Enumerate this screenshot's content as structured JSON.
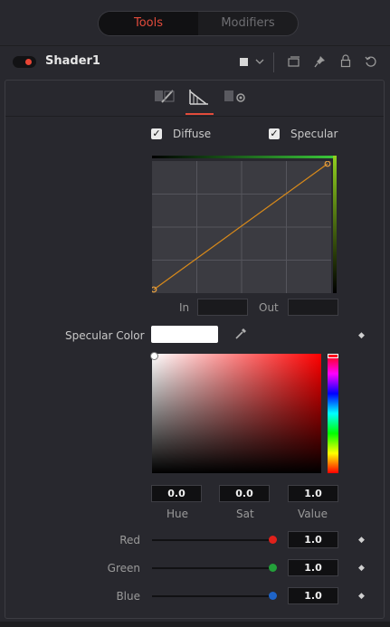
{
  "tabs": {
    "active": "Tools",
    "inactive": "Modifiers"
  },
  "node": {
    "name": "Shader1"
  },
  "header_icons": [
    "color-swatch-square",
    "chevron-down-icon",
    "window-icon",
    "pin-icon",
    "lock-icon",
    "reset-icon"
  ],
  "subtab_icons": [
    "paint-icon",
    "curve-icon",
    "settings-icon"
  ],
  "checkboxes": {
    "diffuse": "Diffuse",
    "specular": "Specular",
    "check_mark": "✓"
  },
  "curve": {
    "in_label": "In",
    "out_label": "Out",
    "in_value": "",
    "out_value": ""
  },
  "specular_color": {
    "label": "Specular Color",
    "swatch_color": "#ffffff",
    "hue": "0.0",
    "sat": "0.0",
    "value": "1.0",
    "hue_label": "Hue",
    "sat_label": "Sat",
    "value_label": "Value"
  },
  "channels": [
    {
      "label": "Red",
      "value": "1.0",
      "color": "#e0211b",
      "level": 1.0
    },
    {
      "label": "Green",
      "value": "1.0",
      "color": "#23a03a",
      "level": 1.0
    },
    {
      "label": "Blue",
      "value": "1.0",
      "color": "#1e64c8",
      "level": 1.0
    }
  ],
  "colors": {
    "accent": "#e24b3b",
    "curve_line": "#d98a1a"
  }
}
